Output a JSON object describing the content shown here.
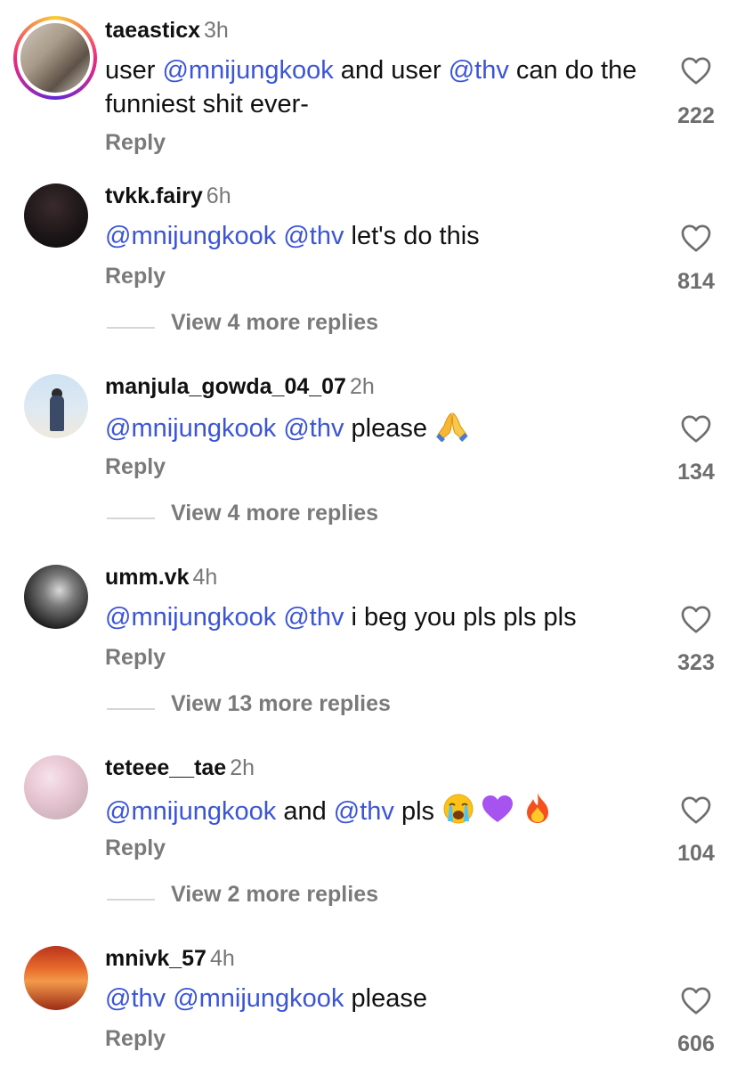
{
  "comments": [
    {
      "username": "taeasticx",
      "time": "3h",
      "text_parts": [
        {
          "t": "user ",
          "m": false
        },
        {
          "t": "@mnijungkook",
          "m": true
        },
        {
          "t": " and user ",
          "m": false
        },
        {
          "t": "@thv",
          "m": true
        },
        {
          "t": " can do the funniest shit ever-",
          "m": false
        }
      ],
      "reply_label": "Reply",
      "likes": "222",
      "view_more": ""
    },
    {
      "username": "tvkk.fairy",
      "time": "6h",
      "text_parts": [
        {
          "t": "@mnijungkook",
          "m": true
        },
        {
          "t": " ",
          "m": false
        },
        {
          "t": "@thv",
          "m": true
        },
        {
          "t": " let's do this",
          "m": false
        }
      ],
      "reply_label": "Reply",
      "likes": "814",
      "view_more": "View 4 more replies"
    },
    {
      "username": "manjula_gowda_04_07",
      "time": "2h",
      "text_parts": [
        {
          "t": "@mnijungkook",
          "m": true
        },
        {
          "t": " ",
          "m": false
        },
        {
          "t": "@thv",
          "m": true
        },
        {
          "t": " please ",
          "m": false
        }
      ],
      "emojis": [
        "pray"
      ],
      "reply_label": "Reply",
      "likes": "134",
      "view_more": "View 4 more replies"
    },
    {
      "username": "umm.vk",
      "time": "4h",
      "text_parts": [
        {
          "t": "@mnijungkook",
          "m": true
        },
        {
          "t": " ",
          "m": false
        },
        {
          "t": "@thv",
          "m": true
        },
        {
          "t": " i beg you pls pls pls",
          "m": false
        }
      ],
      "reply_label": "Reply",
      "likes": "323",
      "view_more": "View 13 more replies"
    },
    {
      "username": "teteee__tae",
      "time": "2h",
      "text_parts": [
        {
          "t": "@mnijungkook",
          "m": true
        },
        {
          "t": " and ",
          "m": false
        },
        {
          "t": "@thv",
          "m": true
        },
        {
          "t": " pls ",
          "m": false
        }
      ],
      "emojis": [
        "crying",
        "purple-heart",
        "fire"
      ],
      "reply_label": "Reply",
      "likes": "104",
      "view_more": "View 2 more replies"
    },
    {
      "username": "mnivk_57",
      "time": "4h",
      "text_parts": [
        {
          "t": "@thv",
          "m": true
        },
        {
          "t": " ",
          "m": false
        },
        {
          "t": "@mnijungkook",
          "m": true
        },
        {
          "t": " please",
          "m": false
        }
      ],
      "reply_label": "Reply",
      "likes": "606",
      "view_more": ""
    }
  ],
  "colors": {
    "mention": "#3b55d6",
    "muted": "#7a7a7a",
    "text": "#111111"
  }
}
